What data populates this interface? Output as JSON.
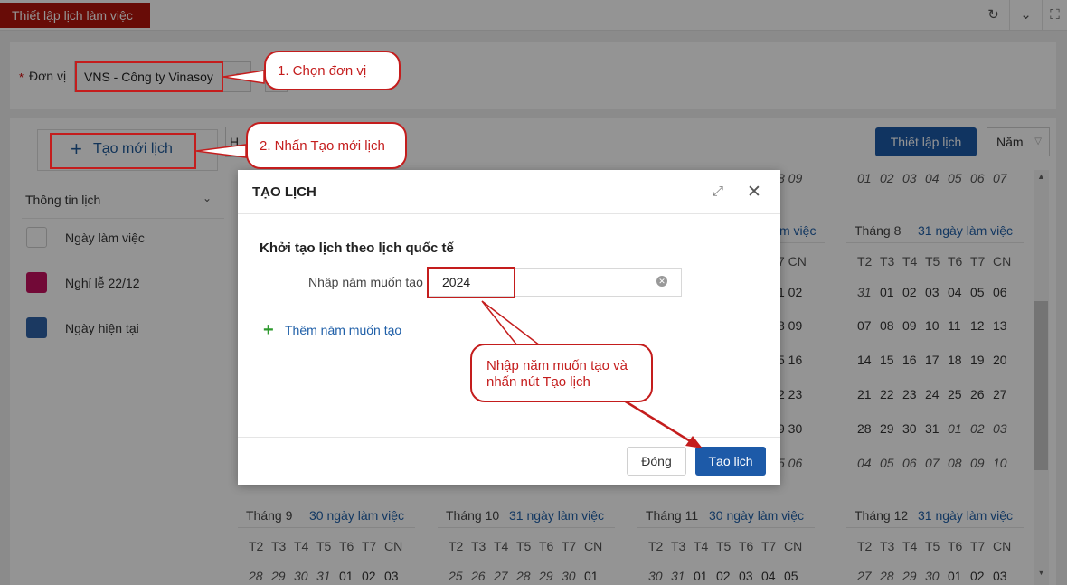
{
  "window": {
    "title_tab": "Thiết lập lịch làm việc",
    "icons": [
      "refresh-icon",
      "chevron-down-icon",
      "fullscreen-icon"
    ]
  },
  "filter": {
    "unit_label": "Đơn vị",
    "required_mark": "*",
    "unit_value": "VNS - Công ty Vinasoy"
  },
  "toolbar": {
    "new_calendar_label": "Tạo mới lịch",
    "partial_text": "H",
    "setup_button": "Thiết lập lịch",
    "view_select": "Năm"
  },
  "sidebar": {
    "info_header": "Thông tin lịch",
    "legend": [
      {
        "label": "Ngày làm việc",
        "color": "#ffffff"
      },
      {
        "label": "Nghỉ lễ 22/12",
        "color": "#c4115f"
      },
      {
        "label": "Ngày hiện tại",
        "color": "#2f63a8"
      }
    ]
  },
  "calendar": {
    "weekday_headers": [
      "T2",
      "T3",
      "T4",
      "T5",
      "T6",
      "T7",
      "CN"
    ],
    "month8": {
      "name": "Tháng 8",
      "workdays": "31 ngày làm việc",
      "rows": [
        [
          "31",
          "01",
          "02",
          "03",
          "04",
          "05",
          "06"
        ],
        [
          "07",
          "08",
          "09",
          "10",
          "11",
          "12",
          "13"
        ],
        [
          "14",
          "15",
          "16",
          "17",
          "18",
          "19",
          "20"
        ],
        [
          "21",
          "22",
          "23",
          "24",
          "25",
          "26",
          "27"
        ],
        [
          "28",
          "29",
          "30",
          "31",
          "01",
          "02",
          "03"
        ],
        [
          "04",
          "05",
          "06",
          "07",
          "08",
          "09",
          "10"
        ]
      ]
    },
    "month8_prev_row": [
      "01",
      "02",
      "03",
      "04",
      "05",
      "06",
      "07"
    ],
    "month7_partial": {
      "workdays_tail": "m việc",
      "header_tail": "7 CN",
      "prev_tail": "8 09",
      "rows": [
        "1 02",
        "8 09",
        "5 16",
        "2 23",
        "9 30",
        "5 06"
      ]
    },
    "bottom_months": [
      {
        "name": "Tháng 9",
        "workdays": "30 ngày làm việc",
        "first_row": [
          "28",
          "29",
          "30",
          "31",
          "01",
          "02",
          "03"
        ]
      },
      {
        "name": "Tháng 10",
        "workdays": "31 ngày làm việc",
        "first_row": [
          "25",
          "26",
          "27",
          "28",
          "29",
          "30",
          "01"
        ]
      },
      {
        "name": "Tháng 11",
        "workdays": "30 ngày làm việc",
        "first_row": [
          "30",
          "31",
          "01",
          "02",
          "03",
          "04",
          "05"
        ]
      },
      {
        "name": "Tháng 12",
        "workdays": "31 ngày làm việc",
        "first_row": [
          "27",
          "28",
          "29",
          "30",
          "01",
          "02",
          "03"
        ]
      }
    ]
  },
  "modal": {
    "title": "TẠO LỊCH",
    "heading": "Khởi tạo lịch theo lịch quốc tế",
    "year_label": "Nhập năm muốn tạo",
    "year_value": "2024",
    "add_year": "Thêm năm muốn tạo",
    "close_button": "Đóng",
    "create_button": "Tạo lịch"
  },
  "annotations": {
    "step1": "1. Chọn đơn vị",
    "step2": "2. Nhấn Tạo mới lịch",
    "step3_line1": "Nhập năm muốn tạo và",
    "step3_line2": "nhấn nút Tạo lịch"
  }
}
